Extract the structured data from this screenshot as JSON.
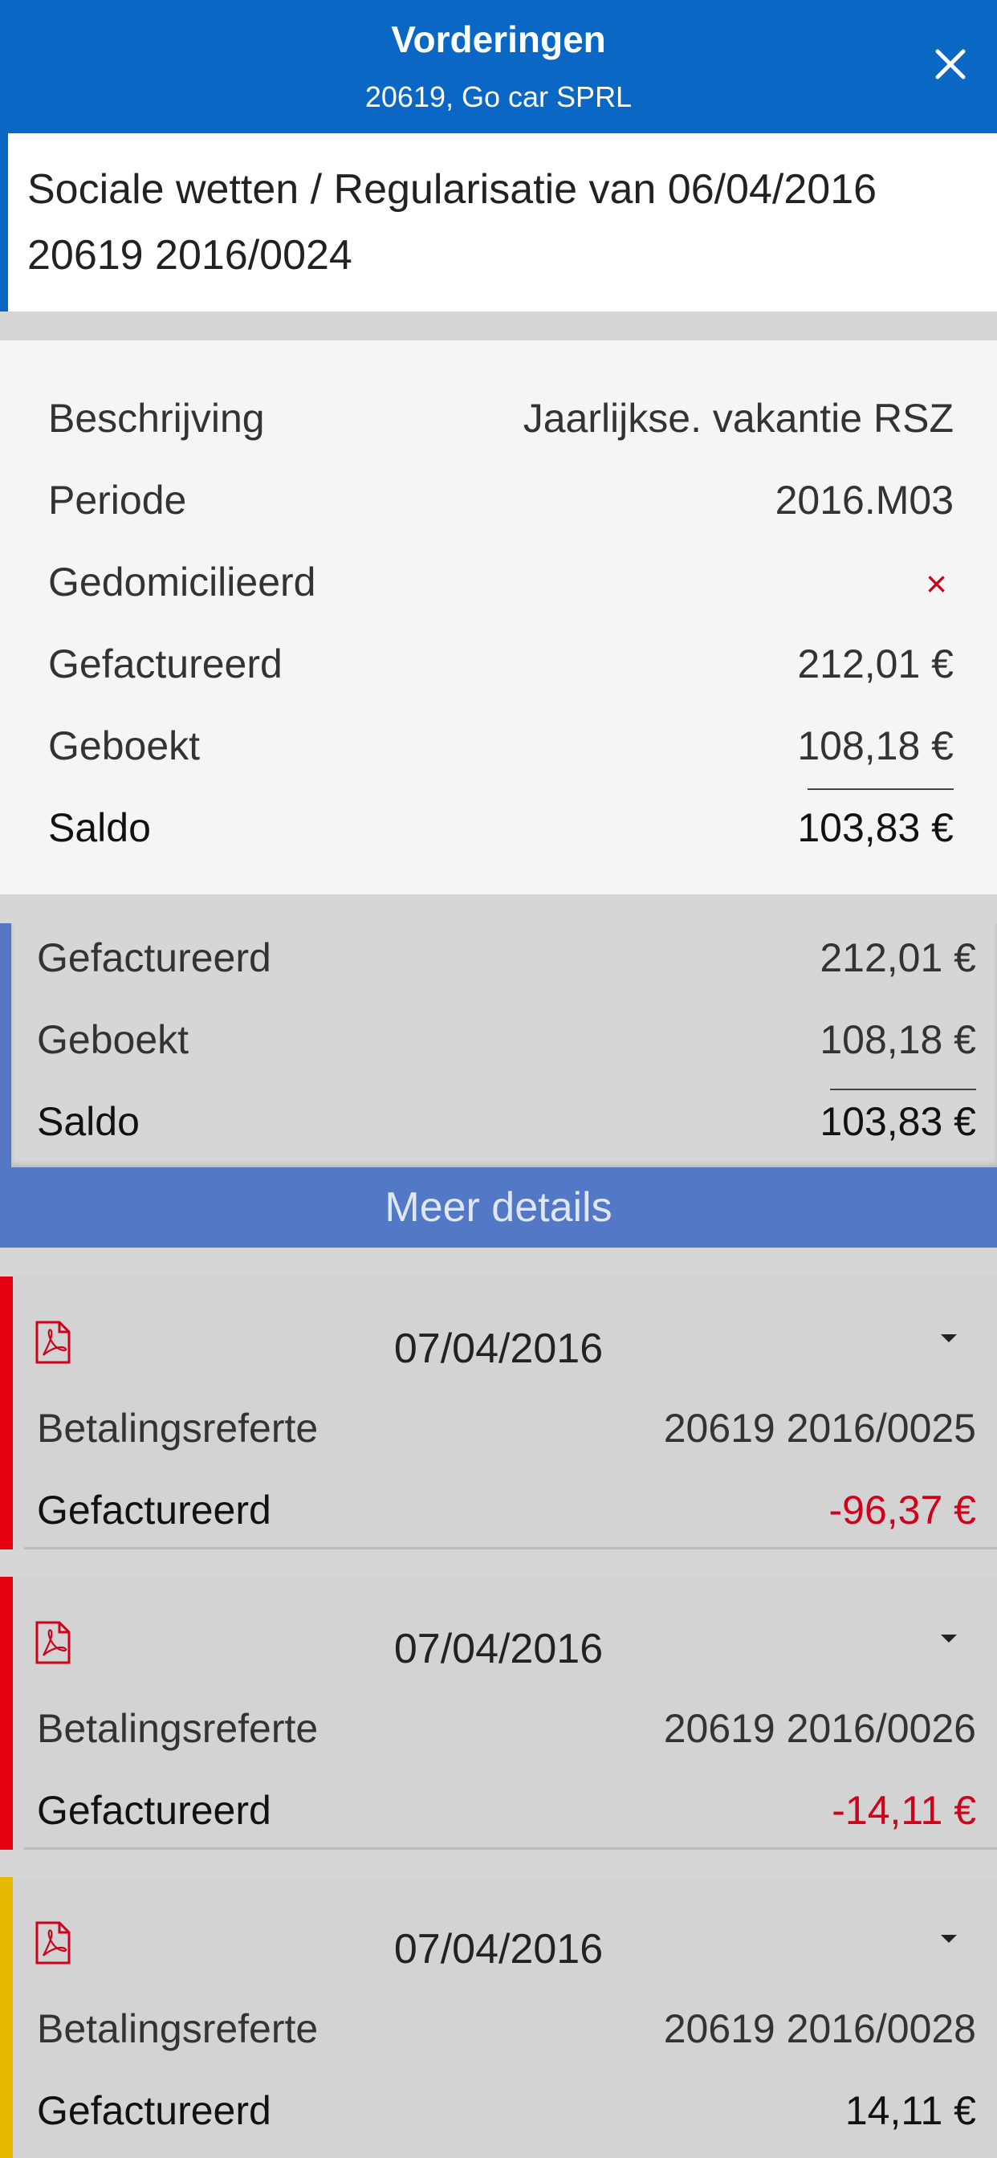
{
  "colors": {
    "header_bg": "#0a68c4",
    "more_bg": "#5278c6",
    "negative": "#d0021b",
    "bar_red": "#e3000f",
    "bar_yellow": "#e6b800"
  },
  "header": {
    "title": "Vorderingen",
    "subtitle": "20619, Go car SPRL",
    "close_icon": "close-icon"
  },
  "subject": {
    "line1": "Sociale wetten / Regularisatie van 06/04/2016",
    "line2": "20619 2016/0024"
  },
  "summary": {
    "rows": [
      {
        "label": "Beschrijving",
        "value": "Jaarlijkse. vakantie RSZ"
      },
      {
        "label": "Periode",
        "value": "2016.M03"
      },
      {
        "label": "Gedomicilieerd",
        "value": "×"
      },
      {
        "label": "Gefactureerd",
        "value": "212,01 €"
      },
      {
        "label": "Geboekt",
        "value": "108,18 €"
      },
      {
        "label": "Saldo",
        "value": "103,83 €"
      }
    ]
  },
  "totals": {
    "rows": [
      {
        "label": "Gefactureerd",
        "value": "212,01 €"
      },
      {
        "label": "Geboekt",
        "value": "108,18 €"
      },
      {
        "label": "Saldo",
        "value": "103,83 €"
      }
    ]
  },
  "more_details": "Meer details",
  "items": [
    {
      "date": "07/04/2016",
      "ref_label": "Betalingsreferte",
      "ref": "20619 2016/0025",
      "amount_label": "Gefactureerd",
      "amount": "-96,37 €",
      "status": "red"
    },
    {
      "date": "07/04/2016",
      "ref_label": "Betalingsreferte",
      "ref": "20619 2016/0026",
      "amount_label": "Gefactureerd",
      "amount": "-14,11 €",
      "status": "red"
    },
    {
      "date": "07/04/2016",
      "ref_label": "Betalingsreferte",
      "ref": "20619 2016/0028",
      "amount_label": "Gefactureerd",
      "amount": "14,11 €",
      "status": "yellow"
    }
  ]
}
